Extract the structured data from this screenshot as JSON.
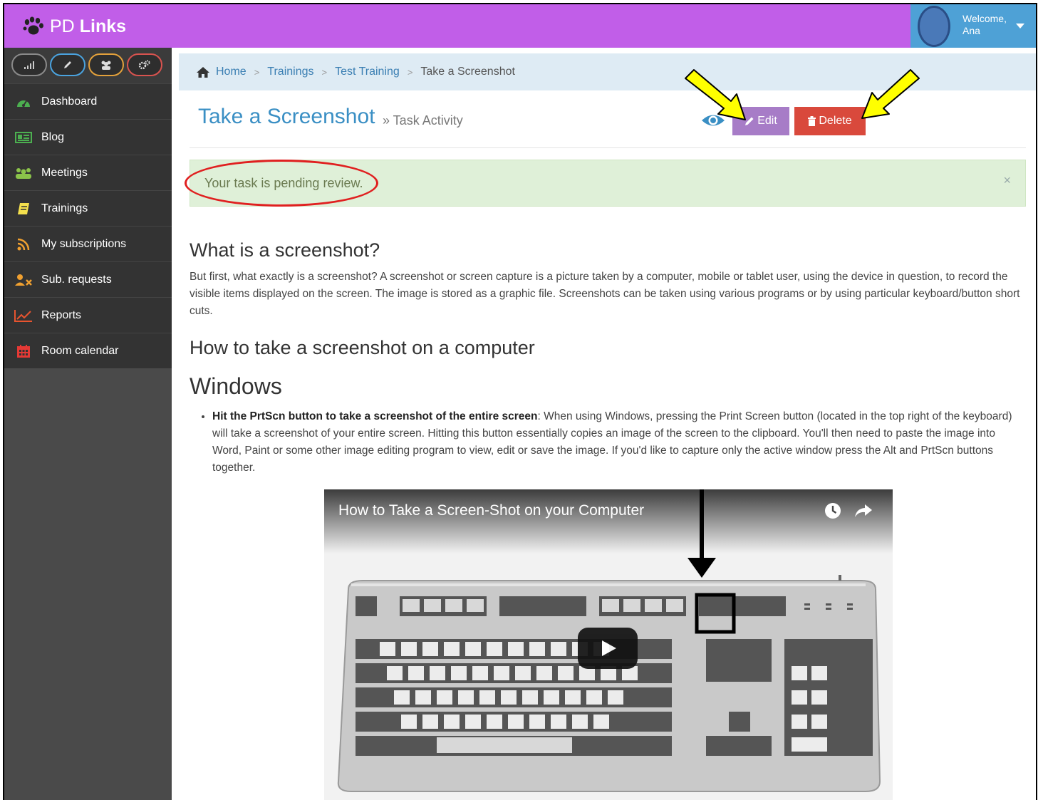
{
  "brand": {
    "prefix": "PD",
    "name": "Links"
  },
  "user": {
    "welcome": "Welcome,",
    "name": "Ana"
  },
  "sidebar": {
    "quick_buttons": [
      {
        "icon": "signal-icon",
        "color": "#8a8a8a"
      },
      {
        "icon": "pencil-icon",
        "color": "#4aa3df"
      },
      {
        "icon": "group-icon",
        "color": "#e3a13b"
      },
      {
        "icon": "gears-icon",
        "color": "#d9534f"
      }
    ],
    "items": [
      {
        "label": "Dashboard",
        "icon": "dashboard-icon",
        "color": "#4caf50"
      },
      {
        "label": "Blog",
        "icon": "newspaper-icon",
        "color": "#4caf50"
      },
      {
        "label": "Meetings",
        "icon": "group-icon",
        "color": "#8bc34a"
      },
      {
        "label": "Trainings",
        "icon": "book-icon",
        "color": "#f4e04d"
      },
      {
        "label": "My subscriptions",
        "icon": "rss-icon",
        "color": "#f0a030"
      },
      {
        "label": "Sub. requests",
        "icon": "user-times-icon",
        "color": "#f0a030"
      },
      {
        "label": "Reports",
        "icon": "line-chart-icon",
        "color": "#e8542f"
      },
      {
        "label": "Room calendar",
        "icon": "calendar-icon",
        "color": "#e53935"
      }
    ]
  },
  "breadcrumb": {
    "home": "Home",
    "trainings": "Trainings",
    "test_training": "Test Training",
    "current": "Take a Screenshot"
  },
  "page": {
    "title": "Take a Screenshot",
    "subtitle": "» Task Activity",
    "edit_label": "Edit",
    "delete_label": "Delete"
  },
  "alert": {
    "text": "Your task is pending review.",
    "close": "×"
  },
  "content": {
    "h_what": "What is a screenshot?",
    "p_what": "But first, what exactly is a screenshot? A screenshot or screen capture is a picture taken by a computer, mobile or tablet user, using the device in question, to record the visible items displayed on the screen. The image is stored as a graphic file. Screenshots can be taken using various programs or by using particular keyboard/button short cuts.",
    "h_how": "How to take a screenshot on a computer",
    "h_windows": "Windows",
    "bullet_bold": "Hit the PrtScn button to take a screenshot of the entire screen",
    "bullet_text": ": When using Windows, pressing the Print Screen button (located in the top right of the keyboard) will take a screenshot of your entire screen. Hitting this button essentially copies an image of the screen to the clipboard. You'll then need to paste the image into Word, Paint or some other image editing program to view, edit or save the image. If you'd like to capture only the active window press the Alt and PrtScn buttons together."
  },
  "video": {
    "title": "How to Take a Screen-Shot on your Computer"
  },
  "colors": {
    "topbar": "#c15ee8",
    "accent_blue": "#3a8fc4",
    "edit": "#a77cc7",
    "delete": "#d9493c",
    "alert_bg": "#dff0d8",
    "annotation_arrow": "#ffff00",
    "annotation_circle": "#e02020"
  }
}
